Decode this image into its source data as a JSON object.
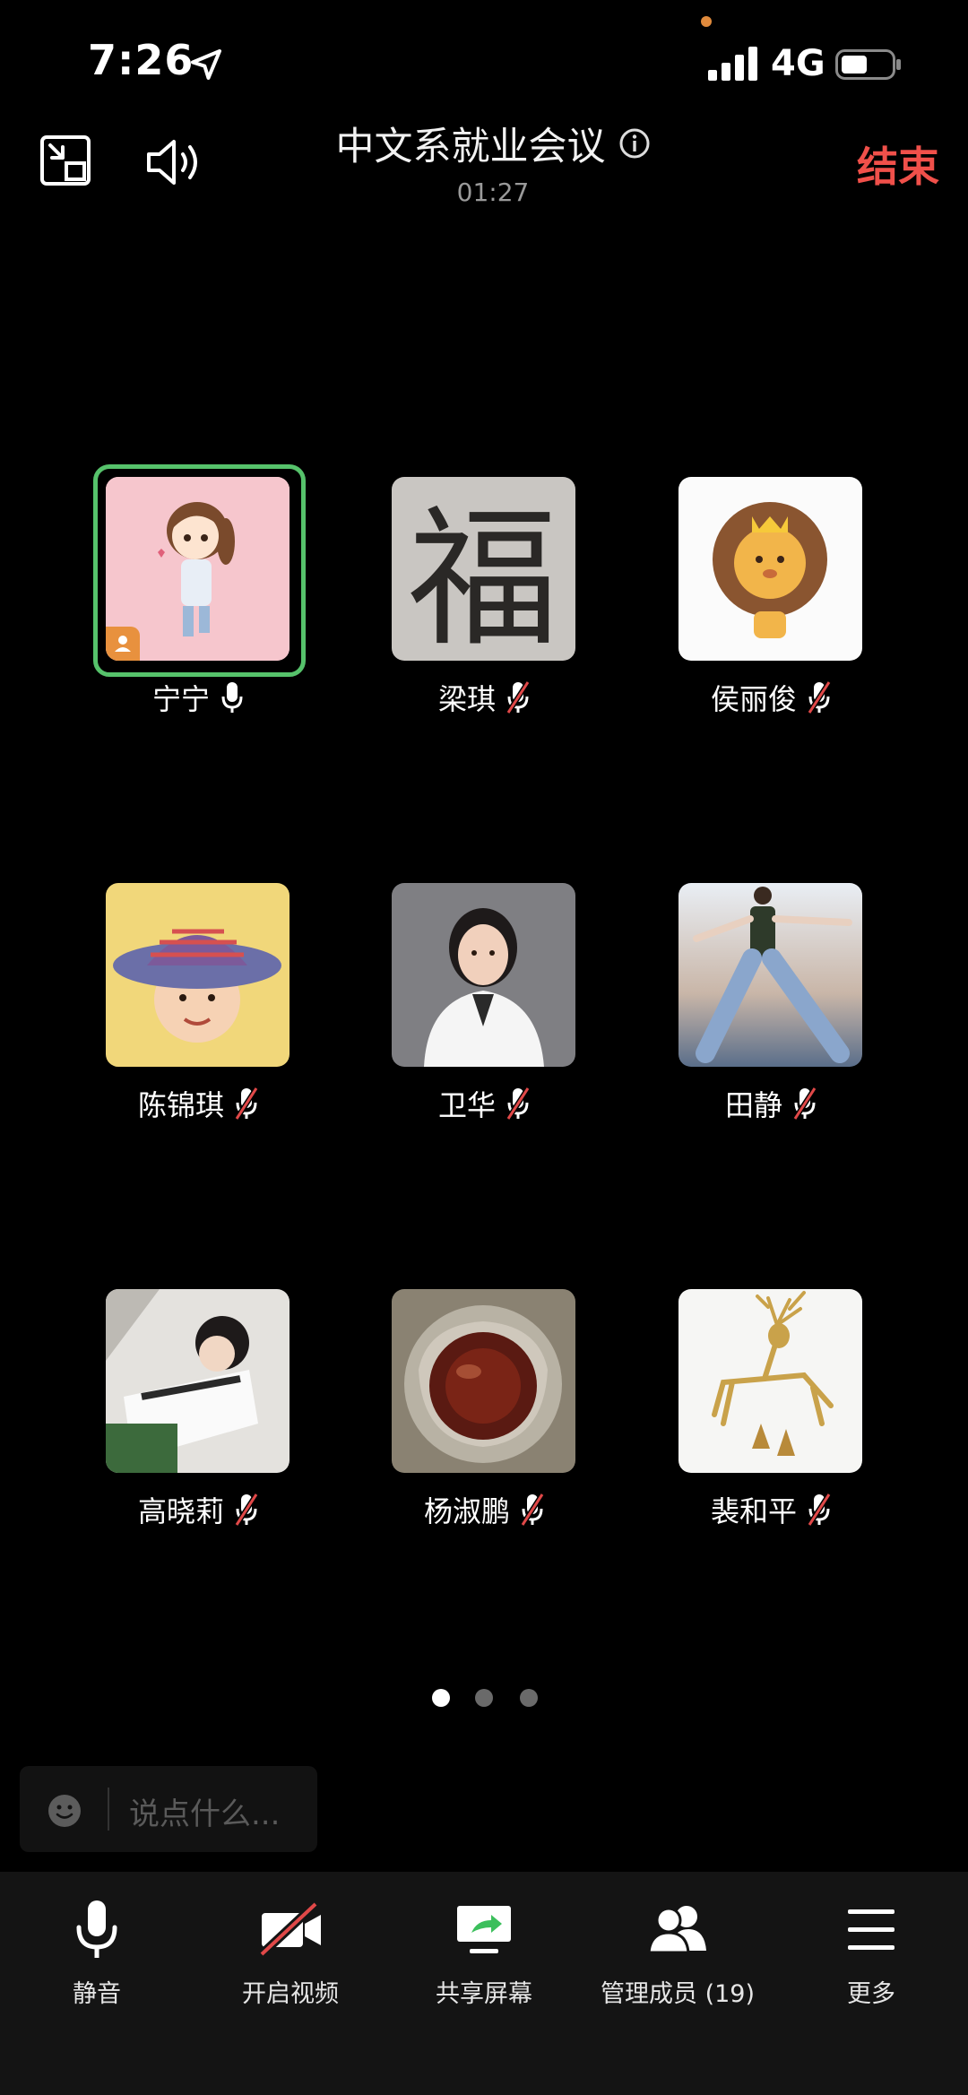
{
  "status_bar": {
    "time": "7:26",
    "network": "4G",
    "icons": [
      "location-arrow-icon",
      "signal-bars-icon",
      "battery-icon"
    ]
  },
  "header": {
    "title": "中文系就业会议",
    "duration": "01:27",
    "end_label": "结束",
    "icons": [
      "exit-pip-icon",
      "speaker-icon",
      "info-icon"
    ]
  },
  "participants": [
    {
      "name": "宁宁",
      "mic": "on",
      "active_speaker": true,
      "host": true
    },
    {
      "name": "梁琪",
      "mic": "muted"
    },
    {
      "name": "侯丽俊",
      "mic": "muted"
    },
    {
      "name": "陈锦琪",
      "mic": "muted"
    },
    {
      "name": "卫华",
      "mic": "muted"
    },
    {
      "name": "田静",
      "mic": "muted"
    },
    {
      "name": "高晓莉",
      "mic": "muted"
    },
    {
      "name": "杨淑鹏",
      "mic": "muted"
    },
    {
      "name": "裴和平",
      "mic": "muted"
    }
  ],
  "avatar_art": {
    "p1": "福"
  },
  "pagination": {
    "current_page": 1,
    "total_pages": 3
  },
  "chat": {
    "placeholder": "说点什么..."
  },
  "toolbar": {
    "mute": "静音",
    "video": "开启视频",
    "share": "共享屏幕",
    "members": "管理成员 (19)",
    "more": "更多"
  },
  "colors": {
    "background": "#000000",
    "end_button": "#f0504a",
    "active_speaker_ring": "#56c26b",
    "muted_slash": "#e04848",
    "host_badge": "#e8913e",
    "toolbar_bg": "#141414"
  }
}
